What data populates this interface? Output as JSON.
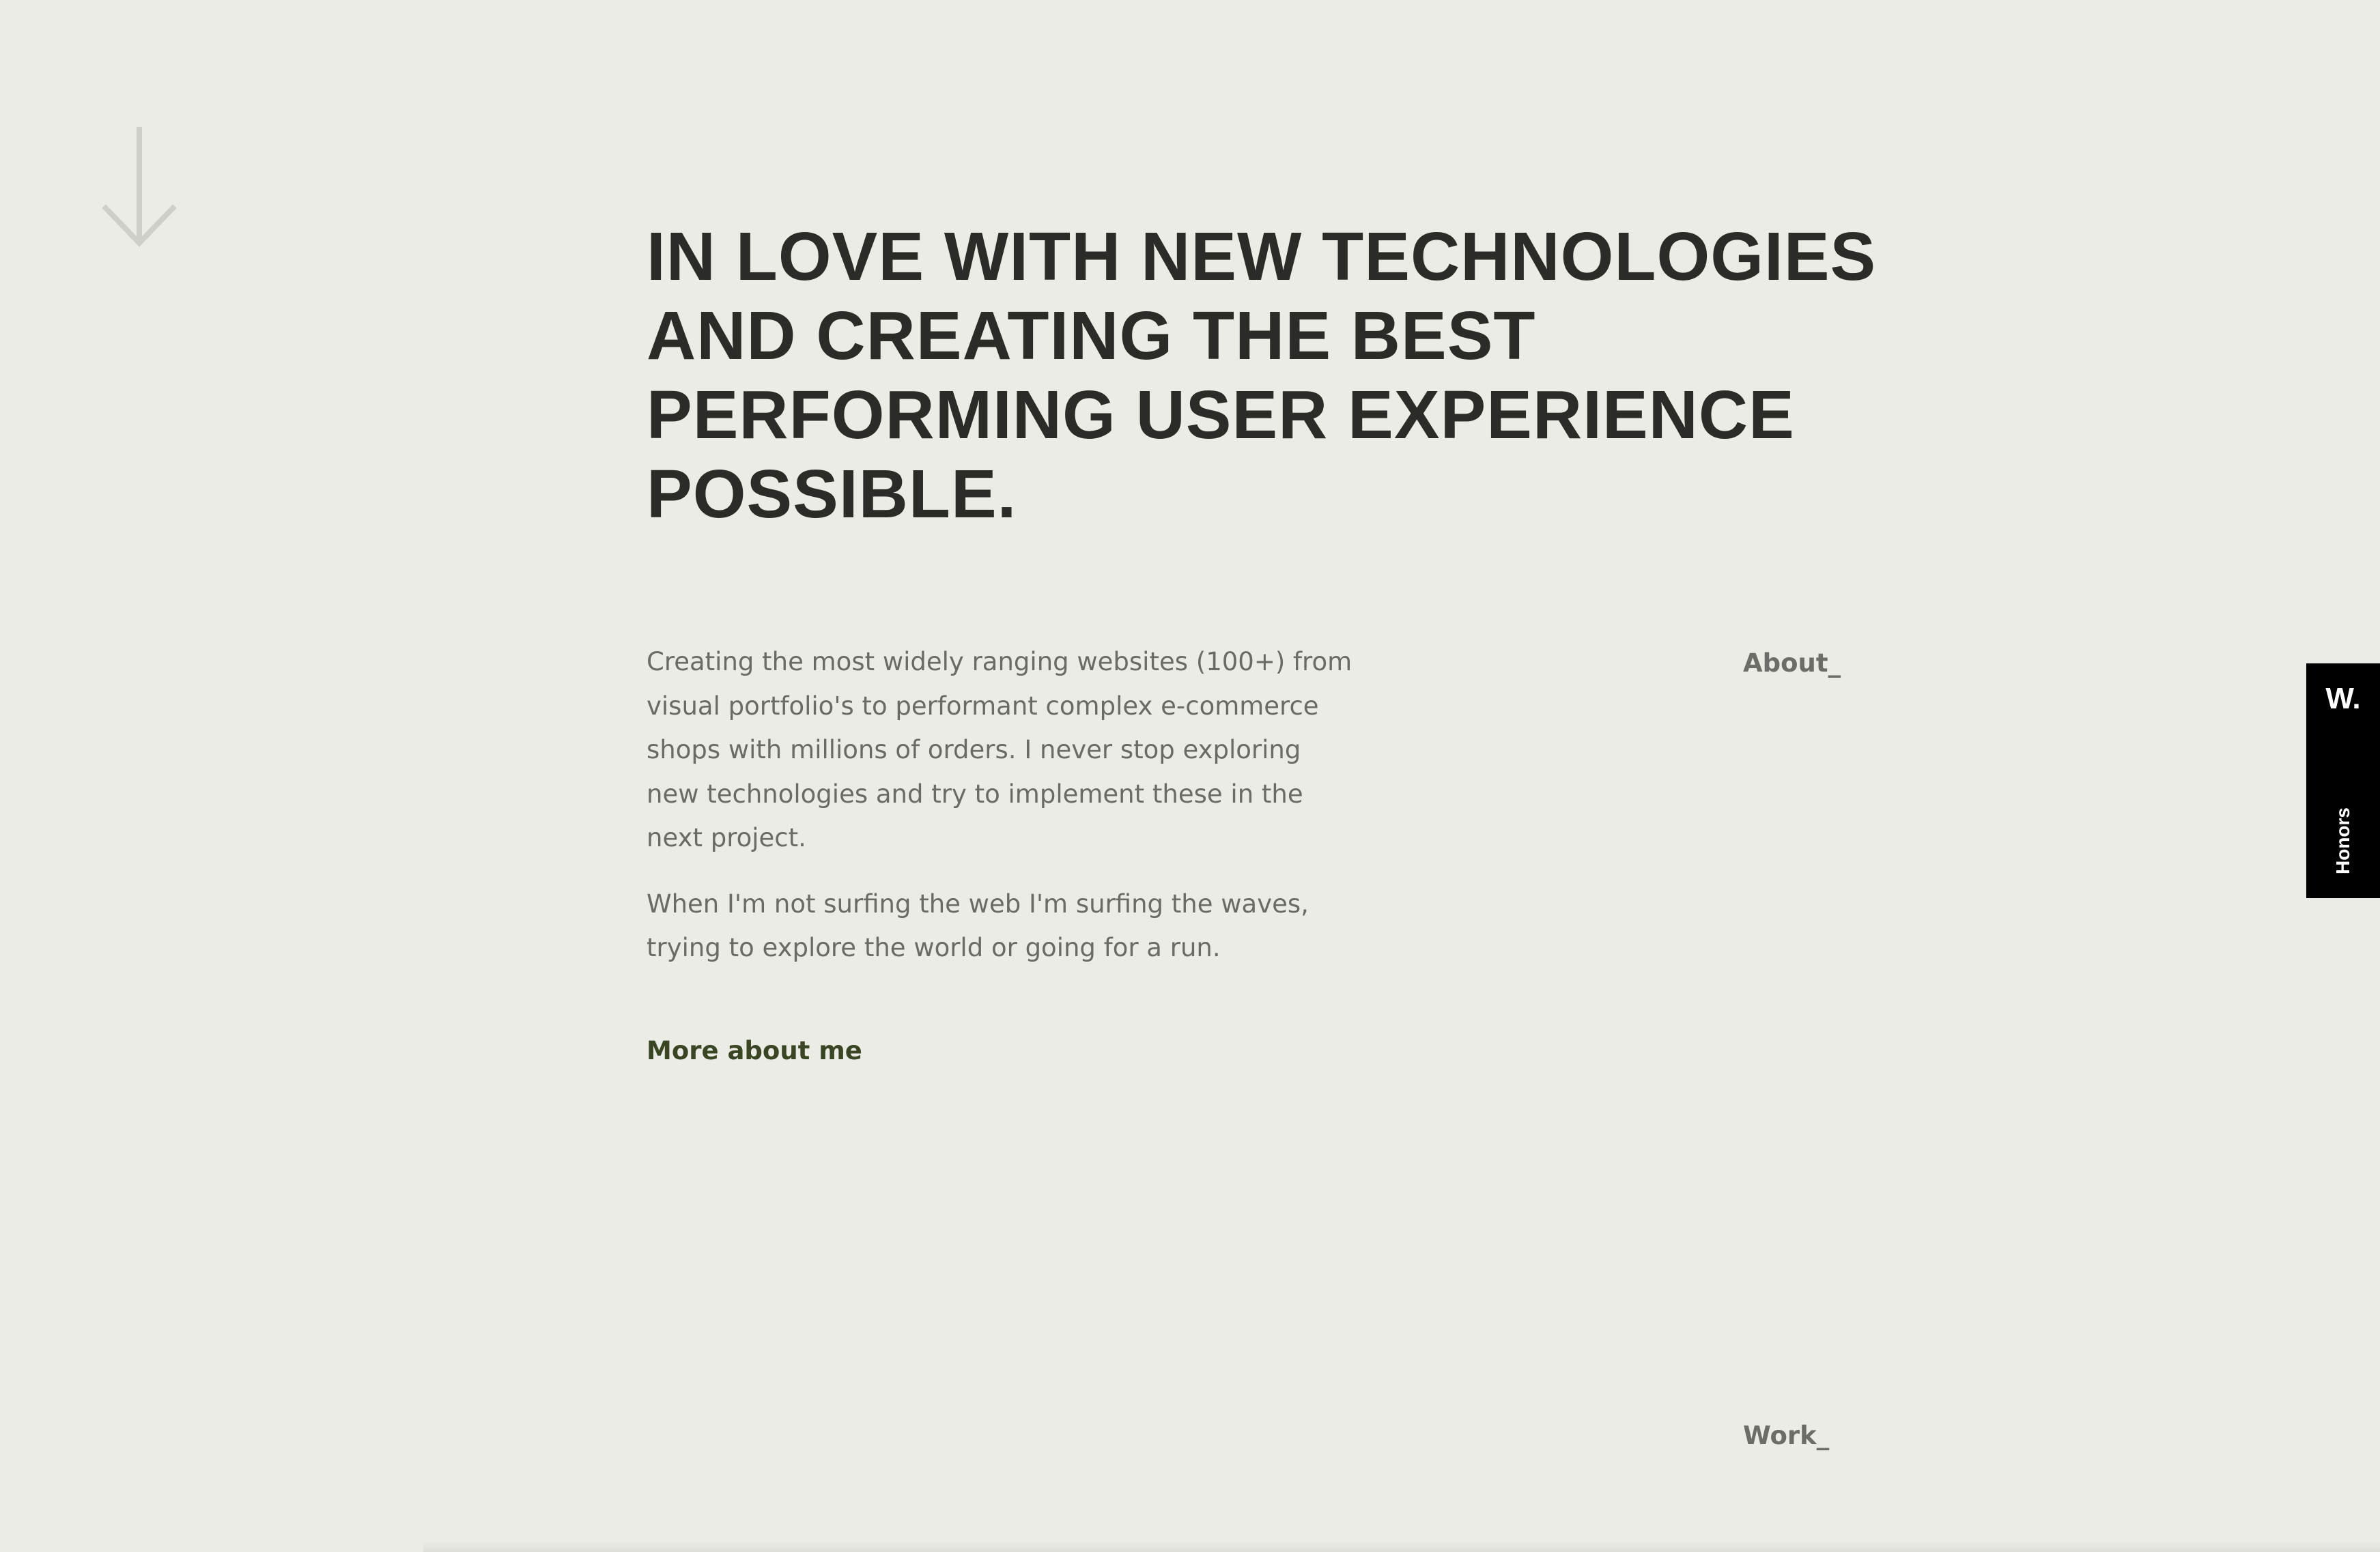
{
  "hero": {
    "headline_lines": [
      "IN LOVE WITH NEW TECHNOLOGIES",
      "AND CREATING THE BEST",
      "PERFORMING USER EXPERIENCE",
      "POSSIBLE."
    ],
    "scroll_icon": "arrow-down-icon"
  },
  "about": {
    "label": "About_",
    "paragraphs": [
      "Creating the most widely ranging websites (100+) from visual portfolio's to performant complex e-commerce shops with millions of orders. I never stop exploring new technologies and try to implement these in the next project.",
      "When I'm not surfing the web I'm surfing the waves, trying to explore the world or going for a run."
    ],
    "more_link": "More about me"
  },
  "work": {
    "label": "Work_"
  },
  "honors_badge": {
    "logo": "W.",
    "text": "Honors"
  },
  "colors": {
    "background": "#ecece7",
    "heading": "#2b2b28",
    "body_text": "#6a6a66",
    "link": "#3a4524",
    "badge": "#000000"
  }
}
